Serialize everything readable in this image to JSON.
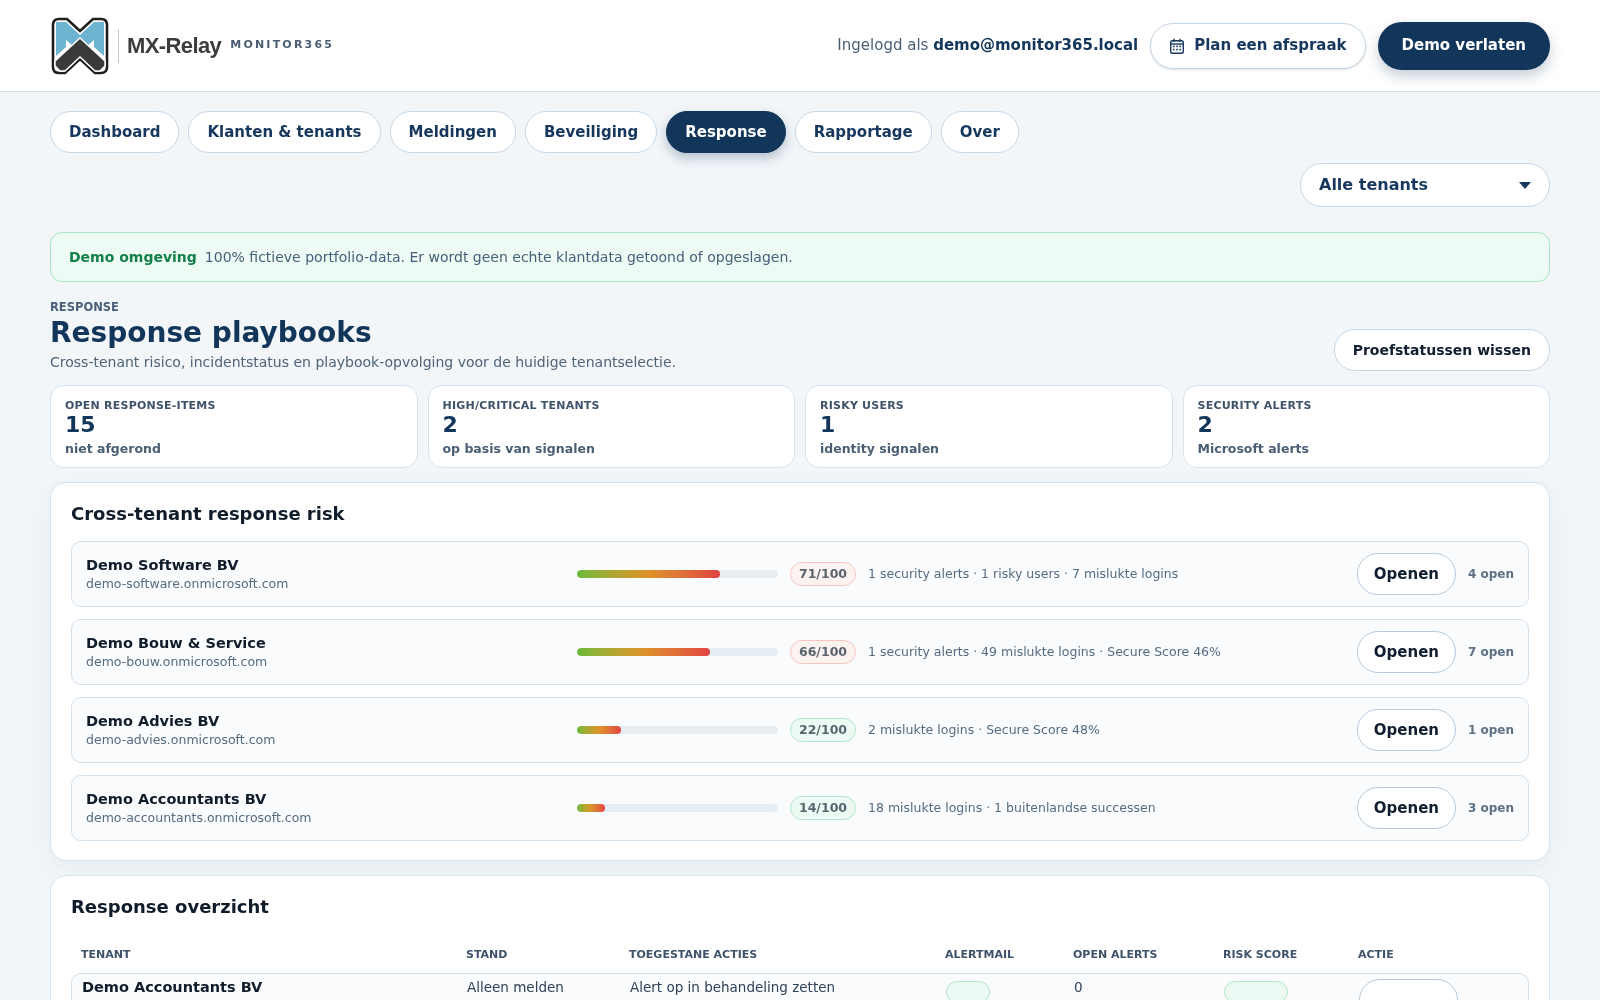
{
  "header": {
    "brand": "MX-Relay",
    "tagline": "MONITOR365",
    "login": "Ingelogd als **demo@monitor365.local**",
    "buttons": [
      {
        "label": "Plan een afspraak",
        "kind": "outline"
      },
      {
        "label": "Demo verlaten",
        "kind": "primary"
      }
    ]
  },
  "tabs": [
    {
      "label": "Dashboard",
      "selected": false
    },
    {
      "label": "Klanten & tenants",
      "selected": false
    },
    {
      "label": "Meldingen",
      "selected": false
    },
    {
      "label": "Beveiliging",
      "selected": false
    },
    {
      "label": "Response",
      "selected": true
    },
    {
      "label": "Rapportage",
      "selected": false
    },
    {
      "label": "Over",
      "selected": false
    }
  ],
  "tenant_filter": {
    "value": "Alle tenants"
  },
  "banner": {
    "title": "Demo omgeving",
    "text": "100% fictieve portfolio-data. Er wordt geen echte klantdata getoond of opgeslagen."
  },
  "page": {
    "eyebrow": "RESPONSE",
    "title": "Response playbooks",
    "subtitle": "Cross-tenant risico, incidentstatus en playbook-opvolging voor de huidige tenantselectie.",
    "action": "Proefstatussen wissen"
  },
  "stats": [
    {
      "label": "OPEN RESPONSE-ITEMS",
      "value": "15",
      "note": "niet afgerond"
    },
    {
      "label": "HIGH/CRITICAL TENANTS",
      "value": "2",
      "note": "op basis van signalen"
    },
    {
      "label": "RISKY USERS",
      "value": "1",
      "note": "identity signalen"
    },
    {
      "label": "SECURITY ALERTS",
      "value": "2",
      "note": "Microsoft alerts"
    }
  ],
  "risk_panel": {
    "title": "Cross-tenant response risk",
    "rows": [
      {
        "name": "Demo Software BV",
        "domain": "demo-software.onmicrosoft.com",
        "level": 0.71,
        "score": "71/100",
        "color": "#f4c8c1",
        "signals": "1 security alerts · 1 risky users · 7 mislukte logins",
        "button": "Openen",
        "open": "4 open"
      },
      {
        "name": "Demo Bouw & Service",
        "domain": "demo-bouw.onmicrosoft.com",
        "level": 0.66,
        "score": "66/100",
        "color": "#f4c8c1",
        "signals": "1 security alerts · 49 mislukte logins · Secure Score 46%",
        "button": "Openen",
        "open": "7 open"
      },
      {
        "name": "Demo Advies BV",
        "domain": "demo-advies.onmicrosoft.com",
        "level": 0.22,
        "score": "22/100",
        "color": "#b3e6cb",
        "signals": "2 mislukte logins · Secure Score 48%",
        "button": "Openen",
        "open": "1 open"
      },
      {
        "name": "Demo Accountants BV",
        "domain": "demo-accountants.onmicrosoft.com",
        "level": 0.14,
        "score": "14/100",
        "color": "#b3e6cb",
        "signals": "18 mislukte logins · 1 buitenlandse successen",
        "button": "Openen",
        "open": "3 open"
      }
    ]
  },
  "overview": {
    "title": "Response overzicht",
    "columns": [
      "TENANT",
      "STAND",
      "TOEGESTANE ACTIES",
      "ALERTMAIL",
      "OPEN ALERTS",
      "RISK SCORE",
      "ACTIE"
    ],
    "rows": [
      {
        "tenant": "Demo Accountants BV",
        "stand": "Alleen melden",
        "actions": "Alert op in behandeling zetten",
        "alertmail": {
          "color": "#b3e6cb"
        },
        "open_alerts": "0",
        "risk_score": {
          "color": "#b3e6cb"
        }
      }
    ]
  }
}
